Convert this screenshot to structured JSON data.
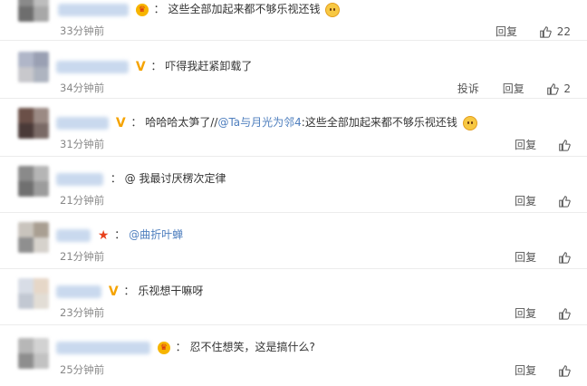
{
  "comments": [
    {
      "text": "这些全部加起来都不够乐视还钱",
      "time": "33分钟前",
      "actions": [
        "回复"
      ],
      "likes": "22",
      "badge": "crown",
      "emoji": "doge-emoji"
    },
    {
      "text": "吓得我赶紧卸载了",
      "time": "34分钟前",
      "actions": [
        "投诉",
        "回复"
      ],
      "likes": "2",
      "badge": "v"
    },
    {
      "text": "哈哈哈太笋了//",
      "mention": "@Ta与月光为邻4",
      "text2": ":这些全部加起来都不够乐视还钱",
      "time": "31分钟前",
      "actions": [
        "回复"
      ],
      "likes": "",
      "badge": "v",
      "emoji": "doge-emoji"
    },
    {
      "text": "@ 我最讨厌楞次定律",
      "time": "21分钟前",
      "actions": [
        "回复"
      ],
      "likes": "",
      "badge": ""
    },
    {
      "mention": "@曲折叶蝉",
      "time": "21分钟前",
      "actions": [
        "回复"
      ],
      "likes": "",
      "badge": "star"
    },
    {
      "text": "乐视想干嘛呀",
      "time": "23分钟前",
      "actions": [
        "回复"
      ],
      "likes": "",
      "badge": "v"
    },
    {
      "text": "忍不住想笑，这是搞什么?",
      "time": "25分钟前",
      "actions": [
        "回复"
      ],
      "likes": "",
      "badge": "crown"
    }
  ],
  "separator": "：",
  "icons": {
    "like": "thumbs-up-icon",
    "crown": "crown-badge-icon",
    "v": "verified-v-badge-icon",
    "star": "star-badge-icon"
  },
  "colors": {
    "link": "#4f7fbe",
    "time": "#888888",
    "v_badge": "#f5a300"
  }
}
